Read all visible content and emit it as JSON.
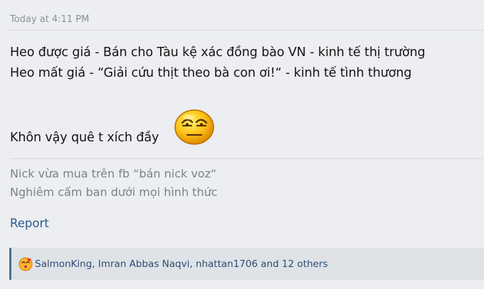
{
  "post": {
    "timestamp": "Today at 4:11 PM",
    "body_lines": [
      "Heo được giá - Bán cho Tàu kệ xác đồng bào VN - kinh tế thị trường",
      "Heo mất giá - “Giải cứu thịt theo bà con ơi!“ - kinh tế tình thương",
      "Khôn vậy quê t xích đầy"
    ],
    "emoji_icon": "annoyed-smiley-icon",
    "signature_lines": [
      "Nick vừa mua trên fb “bán nick voz“",
      "Nghiêm cấm ban dưới mọi hình thức"
    ],
    "report_label": "Report"
  },
  "reactions": {
    "icon": "kiss-face-reaction-icon",
    "text": "SalmonKing, Imran Abbas Naqvi, nhattan1706 and 12 others"
  },
  "colors": {
    "background": "#eceef1",
    "divider": "#d5d8de",
    "body_text": "#141414",
    "muted_text": "#7c818a",
    "link": "#2c5a8e",
    "reaction_bar": "#dfe2e6",
    "reaction_accent": "#4d6d95",
    "reaction_text": "#2a4c75"
  }
}
